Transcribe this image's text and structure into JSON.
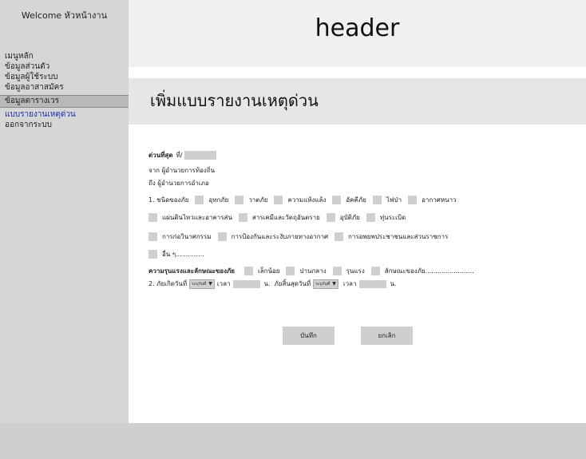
{
  "sidebar": {
    "welcome": "Welcome หัวหน้างาน",
    "items": [
      {
        "label": "เมนูหลัก"
      },
      {
        "label": "ข้อมูลส่วนตัว"
      },
      {
        "label": "ข้อมูลผู้ใช้ระบบ"
      },
      {
        "label": "ข้อมูลอาสาสมัคร"
      },
      {
        "label": "ข้อมูลตารางเวร"
      },
      {
        "label": "แบบรายงานเหตุด่วน"
      },
      {
        "label": "ออกจากระบบ"
      }
    ]
  },
  "header": {
    "title": "header"
  },
  "page": {
    "title": "เพิ่มแบบรายงานเหตุด่วน"
  },
  "form": {
    "urgent_label": "ด่วนที่สุด",
    "ref_label": "ที่/",
    "from_line": "จาก  ผู้อำนวยการท้องถิ่น",
    "to_line": "ถึง   ผู้อำนวยการอำเภอ",
    "type_label": "1. ชนิดของภัย",
    "types": [
      "อุทกภัย",
      "วาตภัย",
      "ความแห้งแล้ง",
      "อัคคีภัย",
      "ไฟป่า",
      "อากาศหนาว",
      "แผ่นดินไหวและอาคารส่น",
      "สารเคมีและวัตถุอันตราย",
      "อุบัติภัย",
      "ทุ่นระเบิด",
      "การก่อวินาศกรรม",
      "การป้องกันและระงับภายทางอากาศ",
      "การอพยพประชาชนและส่วนราชการ",
      "อื่น ๆ.............."
    ],
    "severity_label": "ความรุนแรงและลักษณะของภัย",
    "severity_options": [
      "เล็กน้อย",
      "ปานกลาง",
      "รุนแรง",
      "ลักษณะของภัย........................"
    ],
    "date_line": {
      "label": "2. ภัยเกิดวันที่",
      "select_value": "ระบุวันที่",
      "time_label": "เวลา",
      "unit": "น.",
      "end_label": "ภัยสิ้นสุดวันที่"
    },
    "save_label": "บันทึก",
    "cancel_label": "ยกเลิก"
  }
}
